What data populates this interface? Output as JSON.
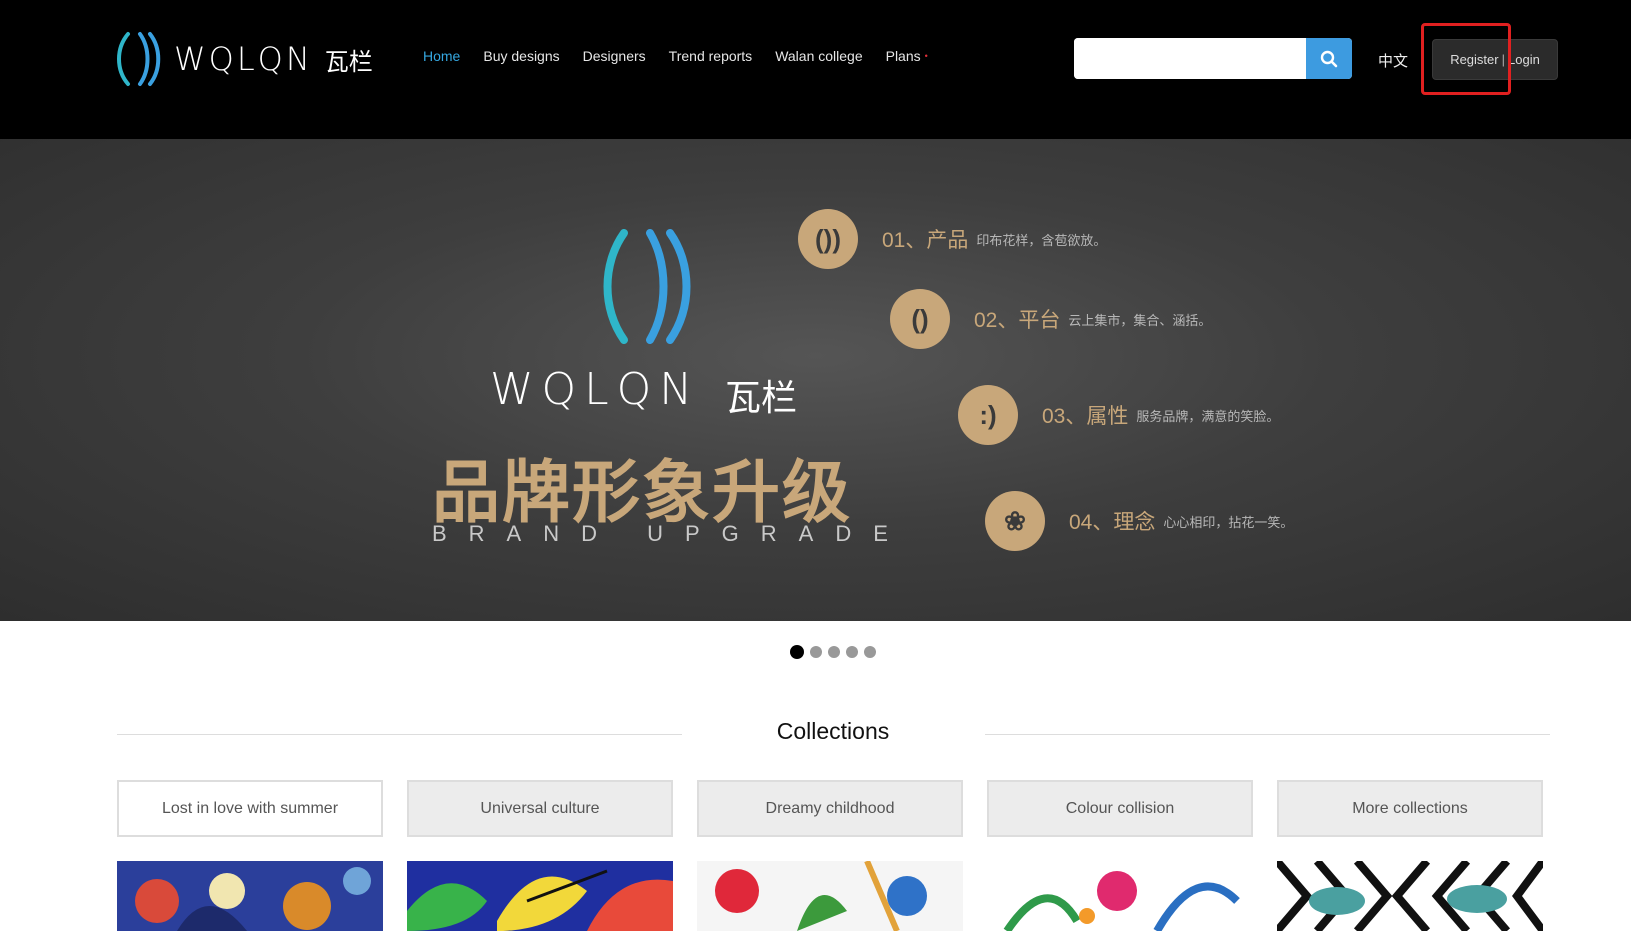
{
  "header": {
    "logo_text": "WQLQN",
    "logo_cn": "瓦栏",
    "nav": [
      {
        "label": "Home",
        "active": true
      },
      {
        "label": "Buy designs"
      },
      {
        "label": "Designers"
      },
      {
        "label": "Trend reports"
      },
      {
        "label": "Walan college"
      },
      {
        "label": "Plans",
        "badge": "•"
      }
    ],
    "search": {
      "placeholder": "",
      "value": "",
      "icon": "search-icon"
    },
    "lang": "中文",
    "auth": {
      "register": "Register",
      "separator": "|",
      "login": "Login"
    }
  },
  "banner": {
    "logo_text": "WQLQN",
    "logo_cn": "瓦栏",
    "headline": "品牌形象升级",
    "sub": "BRAND UPGRADE",
    "features": [
      {
        "badge": "())",
        "title": "01、产品",
        "desc": "印布花样，含苞欲放。"
      },
      {
        "badge": "()",
        "title": "02、平台",
        "desc": "云上集市，集合、涵括。"
      },
      {
        "badge": ":)",
        "title": "03、属性",
        "desc": "服务品牌，满意的笑脸。"
      },
      {
        "badge": "❀",
        "title": "04、理念",
        "desc": "心心相印，拈花一笑。"
      }
    ],
    "slide_count": 5,
    "active_slide": 1
  },
  "collections": {
    "title": "Collections",
    "tabs": [
      {
        "label": "Lost in love with summer",
        "active": true
      },
      {
        "label": "Universal culture"
      },
      {
        "label": "Dreamy childhood"
      },
      {
        "label": "Colour collision"
      },
      {
        "label": "More collections"
      }
    ]
  },
  "colors": {
    "accent": "#35a7e0",
    "gold": "#c8a77a",
    "highlight": "#e02020"
  }
}
